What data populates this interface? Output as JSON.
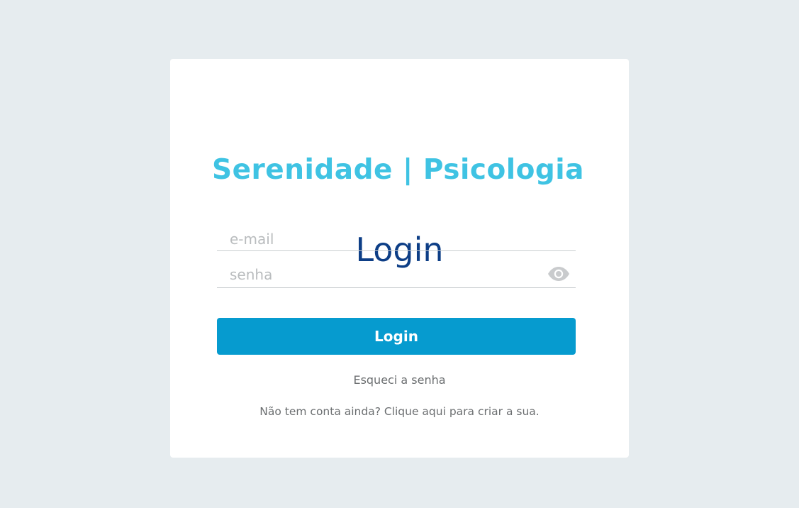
{
  "brand": {
    "title": "Serenidade |  Psicologia"
  },
  "login": {
    "heading": "Login",
    "email_placeholder": "e-mail",
    "password_placeholder": "senha",
    "show_password_icon": "eye-icon",
    "submit_label": "Login",
    "forgot_password_label": "Esqueci a senha",
    "signup_label": "Não tem conta ainda? Clique aqui para criar a sua."
  },
  "colors": {
    "background": "#e6ecef",
    "card": "#ffffff",
    "brand": "#3fc3e3",
    "heading": "#0d3e86",
    "button": "#069bcf",
    "link_text": "#6b6e70",
    "placeholder": "#b9bcbe"
  }
}
